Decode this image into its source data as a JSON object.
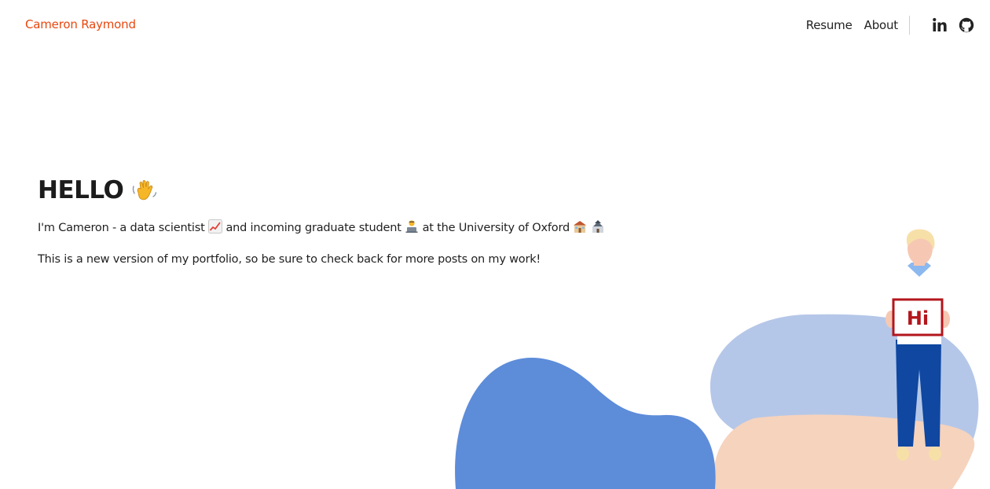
{
  "header": {
    "site_title": "Cameron Raymond",
    "nav": [
      {
        "label": "Resume"
      },
      {
        "label": "About"
      }
    ],
    "social": [
      {
        "icon": "linkedin-icon"
      },
      {
        "icon": "github-icon"
      }
    ]
  },
  "hero": {
    "heading": "HELLO",
    "heading_icon": "waving-hand-icon",
    "intro": {
      "part1": "I'm Cameron - a data scientist",
      "icon1": "chart-increasing-icon",
      "part2": "and incoming graduate student",
      "icon2": "student-at-laptop-icon",
      "part3": "at the University of Oxford",
      "icon3": "school-building-icon",
      "icon4": "castle-icon"
    },
    "body": "This is a new version of my portfolio, so be sure to check back for more posts on my work!"
  },
  "illustration": {
    "sign_text": "Hi"
  },
  "colors": {
    "brand": "#e8470f",
    "blob_blue": "#5d8cd9",
    "blob_light_blue": "#b5c7e8",
    "blob_peach": "#f6d3bd",
    "pants": "#0f47a1",
    "sign_border": "#b3161c"
  }
}
